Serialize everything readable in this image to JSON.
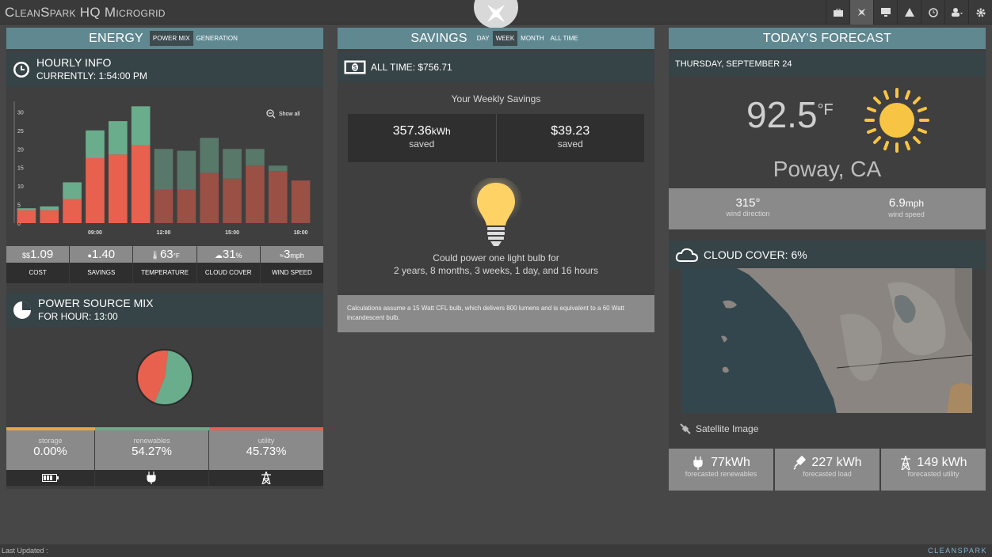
{
  "app": {
    "title": "CleanSpark HQ Microgrid"
  },
  "footer": {
    "last_updated": "Last Updated :",
    "brand": "CLEANSPARK"
  },
  "energy": {
    "title": "ENERGY",
    "tabs": [
      "POWER MIX",
      "GENERATION"
    ],
    "hourly": {
      "title": "HOURLY INFO",
      "current": "CURRENTLY: 1:54:00 PM",
      "show_all": "Show all"
    },
    "stats": [
      {
        "value": "1.09",
        "label": "COST"
      },
      {
        "value": "1.40",
        "label": "SAVINGS"
      },
      {
        "value": "63",
        "unit": "°F",
        "label": "TEMPERATURE"
      },
      {
        "value": "31",
        "unit": "%",
        "label": "CLOUD COVER"
      },
      {
        "value": "3",
        "unit": "mph",
        "label": "WIND SPEED"
      }
    ],
    "power_source": {
      "title": "POWER SOURCE MIX",
      "hour": "FOR HOUR: 13:00"
    },
    "mix": [
      {
        "label": "storage",
        "value": "0.00%"
      },
      {
        "label": "renewables",
        "value": "54.27%"
      },
      {
        "label": "utility",
        "value": "45.73%"
      }
    ]
  },
  "chart_data": {
    "type": "bar",
    "stacked": true,
    "yticks": [
      "0",
      "5",
      "10",
      "15",
      "20",
      "25",
      "30"
    ],
    "xticks": [
      "09:00",
      "12:00",
      "15:00",
      "18:00"
    ],
    "ylim": [
      0,
      32
    ],
    "x": [
      "06:00",
      "07:00",
      "08:00",
      "09:00",
      "10:00",
      "11:00",
      "12:00",
      "13:00",
      "14:00",
      "15:00",
      "16:00",
      "17:00",
      "18:00"
    ],
    "series": [
      {
        "values": [
          3.5,
          3.5,
          6.5,
          17.5,
          18.5,
          21,
          9,
          9,
          13.5,
          12,
          15.5,
          14,
          11.5
        ]
      },
      {
        "values": [
          0.5,
          1,
          4.5,
          7.5,
          9,
          10.5,
          11,
          10.5,
          9.5,
          8,
          4.5,
          1.5,
          0
        ]
      }
    ],
    "past_count": 6,
    "colors": {
      "utility": "#e8614f",
      "renewables": "#6aad8c",
      "utility_dim": "#9a5044",
      "renewables_dim": "#58786a"
    }
  },
  "savings": {
    "title": "SAVINGS",
    "tabs": [
      "DAY",
      "WEEK",
      "MONTH",
      "ALL TIME"
    ],
    "all_time": "ALL TIME: $756.71",
    "weekly_label": "Your Weekly Savings",
    "kwh": "357.36",
    "kwh_unit": "kWh",
    "saved": "saved",
    "dollars": "$39.23",
    "bulb_text_1": "Could power one light bulb for",
    "bulb_text_2": "2 years, 8 months, 3 weeks, 1 day, and 16 hours",
    "note": "Calculations assume a 15 Watt CFL bulb, which delivers 800 lumens and is equivalent to a 60 Watt incandescent bulb."
  },
  "forecast": {
    "title": "TODAY'S FORECAST",
    "date": "THURSDAY, SEPTEMBER 24",
    "temp": "92.5",
    "temp_unit": "°F",
    "location": "Poway, CA",
    "wind_dir": "315°",
    "wind_dir_label": "wind direction",
    "wind_speed": "6.9",
    "wind_speed_unit": "mph",
    "wind_speed_label": "wind speed",
    "cloud_cover": "CLOUD COVER: 6%",
    "satellite": "Satellite Image",
    "items": [
      {
        "value": "77kWh",
        "label": "forecasted renewables"
      },
      {
        "value": "227 kWh",
        "label": "forecasted load"
      },
      {
        "value": "149 kWh",
        "label": "forecasted utility"
      }
    ]
  },
  "pie": {
    "renewables_pct": 54.27,
    "utility_pct": 45.73
  }
}
